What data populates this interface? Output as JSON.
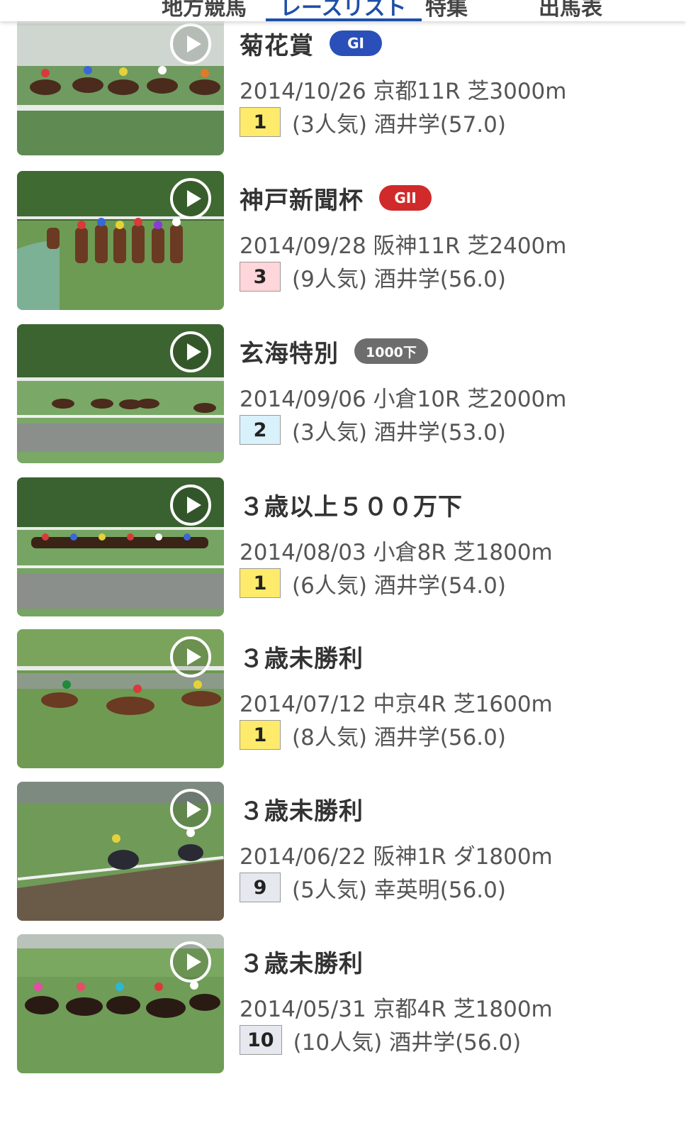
{
  "tabs": [
    {
      "label": "地方競馬",
      "active": false
    },
    {
      "label": "レースリスト",
      "active": true
    },
    {
      "label": "特集",
      "active": false
    },
    {
      "label": "出馬表",
      "active": false
    }
  ],
  "colors": {
    "accent": "#1f4fa8",
    "grade_g1": "#2a4fb8",
    "grade_g2": "#d12a2a",
    "grade_class": "#6d6d6d",
    "rank_1": "#ffeb6b",
    "rank_2": "#d9f1fb",
    "rank_3": "#ffd6d9",
    "rank_other": "#e5e8ee"
  },
  "races": [
    {
      "title": "菊花賞",
      "grade": "GI",
      "grade_type": "g1",
      "meta": "2014/10/26 京都11R 芝3000m",
      "rank": "1",
      "rank_type": "r1",
      "result": "(3人気) 酒井学(57.0)",
      "thumb_icon": "play-icon"
    },
    {
      "title": "神戸新聞杯",
      "grade": "GII",
      "grade_type": "g2",
      "meta": "2014/09/28 阪神11R 芝2400m",
      "rank": "3",
      "rank_type": "r3",
      "result": "(9人気) 酒井学(56.0)",
      "thumb_icon": "play-icon"
    },
    {
      "title": "玄海特別",
      "grade": "1000下",
      "grade_type": "cls",
      "meta": "2014/09/06 小倉10R 芝2000m",
      "rank": "2",
      "rank_type": "r2",
      "result": "(3人気) 酒井学(53.0)",
      "thumb_icon": "play-icon"
    },
    {
      "title": "３歳以上５００万下",
      "grade": "",
      "grade_type": "",
      "meta": "2014/08/03 小倉8R 芝1800m",
      "rank": "1",
      "rank_type": "r1",
      "result": "(6人気) 酒井学(54.0)",
      "thumb_icon": "play-icon"
    },
    {
      "title": "３歳未勝利",
      "grade": "",
      "grade_type": "",
      "meta": "2014/07/12 中京4R 芝1600m",
      "rank": "1",
      "rank_type": "r1",
      "result": "(8人気) 酒井学(56.0)",
      "thumb_icon": "play-icon"
    },
    {
      "title": "３歳未勝利",
      "grade": "",
      "grade_type": "",
      "meta": "2014/06/22 阪神1R ダ1800m",
      "rank": "9",
      "rank_type": "rx",
      "result": "(5人気) 幸英明(56.0)",
      "thumb_icon": "play-icon"
    },
    {
      "title": "３歳未勝利",
      "grade": "",
      "grade_type": "",
      "meta": "2014/05/31 京都4R 芝1800m",
      "rank": "10",
      "rank_type": "rx",
      "result": "(10人気) 酒井学(56.0)",
      "thumb_icon": "play-icon"
    }
  ]
}
